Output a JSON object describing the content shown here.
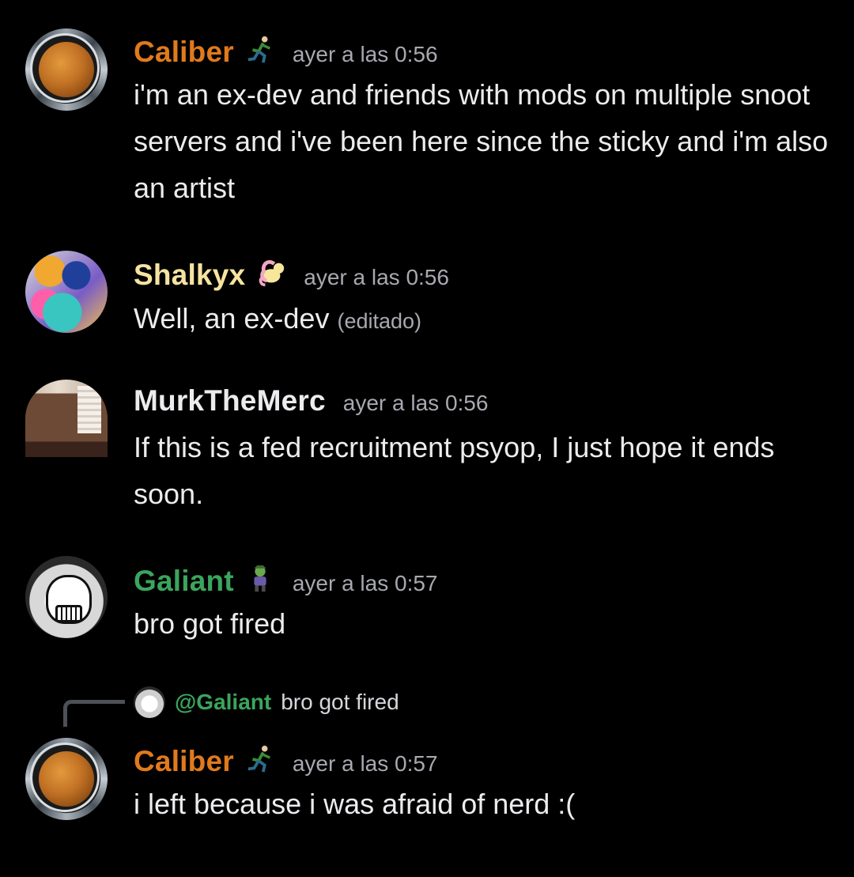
{
  "messages": [
    {
      "author": "Caliber",
      "author_color": "#e07a1c",
      "badge_icon": "running-person-icon",
      "timestamp": "ayer a las 0:56",
      "text": "i'm an ex-dev and friends with mods on multiple snoot servers and i've been here since the sticky and i'm also an artist"
    },
    {
      "author": "Shalkyx",
      "author_color": "#f5e3a0",
      "badge_icon": "pony-icon",
      "timestamp": "ayer a las 0:56",
      "text": "Well, an ex-dev",
      "edited_label": "(editado)"
    },
    {
      "author": "MurkTheMerc",
      "author_color": "#ececef",
      "timestamp": "ayer a las 0:56",
      "text": "If this is a fed recruitment psyop, I just hope it ends soon."
    },
    {
      "author": "Galiant",
      "author_color": "#3ba55d",
      "badge_icon": "goblin-icon",
      "timestamp": "ayer a las 0:57",
      "text": "bro got fired"
    },
    {
      "reply_to": {
        "mention": "@Galiant",
        "text": "bro got fired"
      },
      "author": "Caliber",
      "author_color": "#e07a1c",
      "badge_icon": "running-person-icon",
      "timestamp": "ayer a las 0:57",
      "text": "i left because i was afraid of nerd :("
    }
  ]
}
